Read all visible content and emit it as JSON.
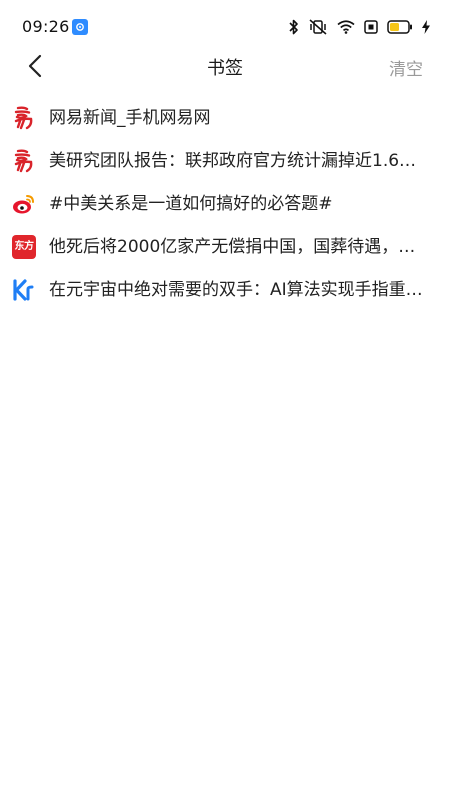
{
  "status_bar": {
    "time": "09:26",
    "battery_color": "#f5c518"
  },
  "header": {
    "title": "书签",
    "clear_label": "清空"
  },
  "bookmarks": [
    {
      "title": "网易新闻_手机网易网",
      "icon": "netease-logo-icon"
    },
    {
      "title": "美研究团队报告：联邦政府官方统计漏掉近1.6…",
      "icon": "netease-logo-icon"
    },
    {
      "title": "#中美关系是一道如何搞好的必答题#",
      "icon": "weibo-logo-icon"
    },
    {
      "title": "他死后将2000亿家产无偿捐中国，国葬待遇，…",
      "icon": "dongfang-logo-icon",
      "icon_text": "东方"
    },
    {
      "title": "在元宇宙中绝对需要的双手：AI算法实现手指重…",
      "icon": "36kr-logo-icon",
      "icon_text": "Kr"
    }
  ]
}
